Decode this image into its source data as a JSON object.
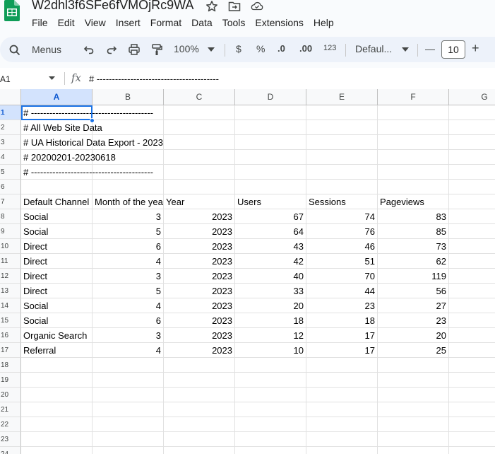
{
  "doc": {
    "title": "W2dhl3f6SFe6fVMOjRc9WA",
    "icons": [
      "star-icon",
      "move-to-folder-icon",
      "cloud-saved-icon"
    ]
  },
  "menus": [
    "File",
    "Edit",
    "View",
    "Insert",
    "Format",
    "Data",
    "Tools",
    "Extensions",
    "Help"
  ],
  "toolbar": {
    "search_menus_label": "Menus",
    "zoom": "100%",
    "currency": "$",
    "percent": "%",
    "decrease_decimal": ".0",
    "increase_decimal": ".00",
    "more_formats": "123",
    "font": "Defaul...",
    "font_size": "10",
    "decrease_font": "—",
    "increase_font": "+"
  },
  "formula_bar": {
    "name_box": "A1",
    "fx": "fx",
    "content": "# ----------------------------------------"
  },
  "columns": [
    "A",
    "B",
    "C",
    "D",
    "E",
    "F",
    "G"
  ],
  "rows": [
    [
      "# ----------------------------------------",
      "",
      "",
      "",
      "",
      ""
    ],
    [
      "# All Web Site Data",
      "",
      "",
      "",
      "",
      ""
    ],
    [
      "# UA Historical Data Export - 2023",
      "",
      "",
      "",
      "",
      ""
    ],
    [
      "# 20200201-20230618",
      "",
      "",
      "",
      "",
      ""
    ],
    [
      "# ----------------------------------------",
      "",
      "",
      "",
      "",
      ""
    ],
    [
      "",
      "",
      "",
      "",
      "",
      ""
    ],
    [
      "Default Channel",
      "Month of the yea",
      "Year",
      "Users",
      "Sessions",
      "Pageviews"
    ],
    [
      "Social",
      "3",
      "2023",
      "67",
      "74",
      "83"
    ],
    [
      "Social",
      "5",
      "2023",
      "64",
      "76",
      "85"
    ],
    [
      "Direct",
      "6",
      "2023",
      "43",
      "46",
      "73"
    ],
    [
      "Direct",
      "4",
      "2023",
      "42",
      "51",
      "62"
    ],
    [
      "Direct",
      "3",
      "2023",
      "40",
      "70",
      "119"
    ],
    [
      "Direct",
      "5",
      "2023",
      "33",
      "44",
      "56"
    ],
    [
      "Social",
      "4",
      "2023",
      "20",
      "23",
      "27"
    ],
    [
      "Social",
      "6",
      "2023",
      "18",
      "18",
      "23"
    ],
    [
      "Organic Search",
      "3",
      "2023",
      "12",
      "17",
      "20"
    ],
    [
      "Referral",
      "4",
      "2023",
      "10",
      "17",
      "25"
    ],
    [
      "",
      "",
      "",
      "",
      "",
      ""
    ],
    [
      "",
      "",
      "",
      "",
      "",
      ""
    ],
    [
      "",
      "",
      "",
      "",
      "",
      ""
    ],
    [
      "",
      "",
      "",
      "",
      "",
      ""
    ],
    [
      "",
      "",
      "",
      "",
      "",
      ""
    ],
    [
      "",
      "",
      "",
      "",
      "",
      ""
    ],
    [
      "",
      "",
      "",
      "",
      "",
      ""
    ]
  ],
  "selected_cell": "A1",
  "colors": {
    "accent": "#1a73e8",
    "header_bg": "#f8f9fa",
    "selected_header_bg": "#d3e3fd",
    "app_green": "#0f9d58"
  }
}
